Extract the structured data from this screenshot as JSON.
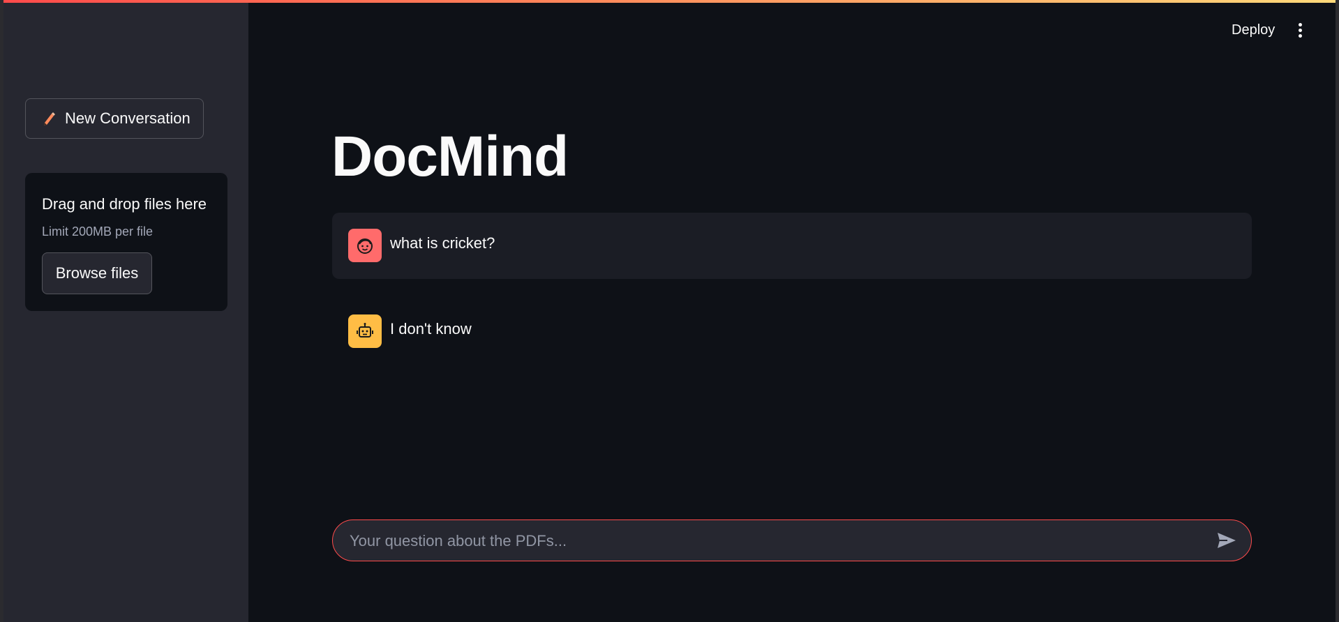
{
  "sidebar": {
    "new_conversation_label": "New Conversation",
    "uploader": {
      "drag_text": "Drag and drop files here",
      "limit_text": "Limit 200MB per file",
      "browse_label": "Browse files"
    }
  },
  "header": {
    "deploy_label": "Deploy",
    "menu_icon": "kebab-menu-icon"
  },
  "main": {
    "title": "DocMind",
    "messages": [
      {
        "role": "user",
        "avatar_icon": "user-face-icon",
        "text": "what is cricket?"
      },
      {
        "role": "assistant",
        "avatar_icon": "robot-icon",
        "text": "I don't know"
      }
    ],
    "chat_input": {
      "placeholder": "Your question about the PDFs...",
      "value": "",
      "send_icon": "send-icon"
    }
  },
  "colors": {
    "background": "#0e1117",
    "sidebar": "#262730",
    "accent": "#ff4b4b",
    "user_avatar": "#ff6b6b",
    "bot_avatar": "#ffbd45"
  }
}
